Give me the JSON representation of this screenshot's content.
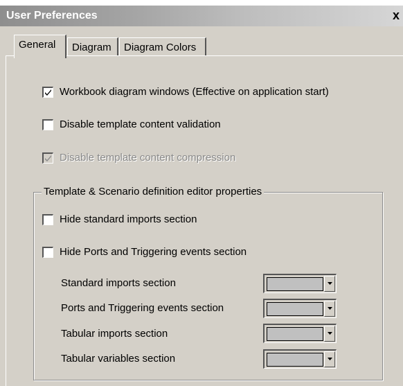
{
  "window": {
    "title": "User Preferences",
    "close_glyph": "x"
  },
  "tabs": [
    {
      "label": "General",
      "active": true
    },
    {
      "label": "Diagram",
      "active": false
    },
    {
      "label": "Diagram Colors",
      "active": false
    }
  ],
  "general": {
    "options": [
      {
        "label": "Workbook diagram windows (Effective on application start)",
        "checked": true,
        "enabled": true
      },
      {
        "label": "Disable template content validation",
        "checked": false,
        "enabled": true
      },
      {
        "label": "Disable template content compression",
        "checked": true,
        "enabled": false
      }
    ],
    "editor_group": {
      "legend": "Template & Scenario definition editor properties",
      "options": [
        {
          "label": "Hide standard imports section",
          "checked": false
        },
        {
          "label": "Hide Ports and Triggering events section",
          "checked": false
        }
      ],
      "color_fields": [
        {
          "label": "Standard imports section",
          "color": "#c0c0c0"
        },
        {
          "label": "Ports and Triggering events section",
          "color": "#c0c0c0"
        },
        {
          "label": "Tabular imports section",
          "color": "#c0c0c0"
        },
        {
          "label": "Tabular variables section",
          "color": "#c0c0c0"
        }
      ]
    }
  },
  "colors": {
    "dialog_bg": "#d4d0c8",
    "swatch_default": "#c0c0c0",
    "disabled_text": "#8a8a8a"
  }
}
